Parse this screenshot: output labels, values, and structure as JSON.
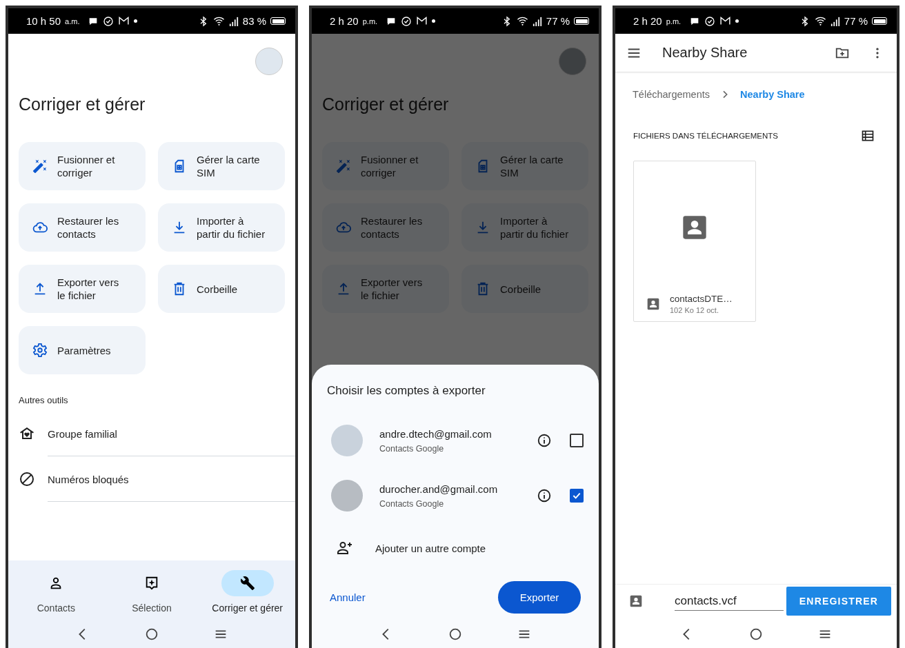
{
  "contacts_screen": {
    "status_bar": {
      "time": "10 h 50",
      "period": "a.m.",
      "battery": "83 %"
    },
    "title": "Corriger et gérer",
    "tools": [
      {
        "label": "Fusionner et corriger",
        "kind": "wand"
      },
      {
        "label": "Gérer la carte SIM",
        "kind": "sim"
      },
      {
        "label": "Restaurer les contacts",
        "kind": "cloud"
      },
      {
        "label": "Importer à partir du fichier",
        "kind": "download"
      },
      {
        "label": "Exporter vers le fichier",
        "kind": "upload"
      },
      {
        "label": "Corbeille",
        "kind": "trash"
      },
      {
        "label": "Paramètres",
        "kind": "gear"
      }
    ],
    "other_tools_heading": "Autres outils",
    "other_tools": [
      {
        "label": "Groupe familial",
        "kind": "family"
      },
      {
        "label": "Numéros bloqués",
        "kind": "block"
      }
    ],
    "bottom_nav": [
      {
        "label": "Contacts",
        "kind": "person",
        "selected": false
      },
      {
        "label": "Sélection",
        "kind": "sparkle",
        "selected": false
      },
      {
        "label": "Corriger et gérer",
        "kind": "wrench",
        "selected": true
      }
    ]
  },
  "export_screen": {
    "status_bar": {
      "time": "2 h 20",
      "period": "p.m.",
      "battery": "77 %"
    },
    "title": "Corriger et gérer",
    "tools": [
      {
        "label": "Fusionner et corriger",
        "kind": "wand"
      },
      {
        "label": "Gérer la carte SIM",
        "kind": "sim"
      },
      {
        "label": "Restaurer les contacts",
        "kind": "cloud"
      },
      {
        "label": "Importer à partir du fichier",
        "kind": "download"
      },
      {
        "label": "Exporter vers le fichier",
        "kind": "upload"
      },
      {
        "label": "Corbeille",
        "kind": "trash"
      }
    ],
    "sheet": {
      "title": "Choisir les comptes à exporter",
      "accounts": [
        {
          "email": "andre.dtech@gmail.com",
          "source": "Contacts Google",
          "checked": false
        },
        {
          "email": "durocher.and@gmail.com",
          "source": "Contacts Google",
          "checked": true
        }
      ],
      "add_account": "Ajouter un autre compte",
      "cancel": "Annuler",
      "confirm": "Exporter"
    }
  },
  "files_screen": {
    "status_bar": {
      "time": "2 h 20",
      "period": "p.m.",
      "battery": "77 %"
    },
    "title": "Nearby Share",
    "breadcrumb": [
      {
        "label": "Téléchargements",
        "selected": false
      },
      {
        "label": "Nearby Share",
        "selected": true
      }
    ],
    "section_heading": "FICHIERS DANS TÉLÉCHARGEMENTS",
    "files": [
      {
        "name": "contactsDTE…",
        "meta": "102 Ko 12 oct."
      }
    ],
    "filename": "contacts.vcf",
    "save": "ENREGISTRER"
  }
}
